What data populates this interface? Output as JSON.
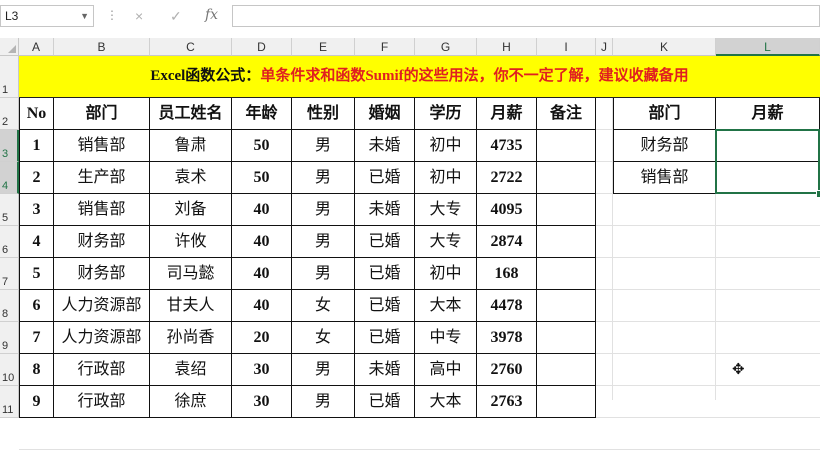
{
  "toolbar": {
    "name_box": "L3",
    "cancel_icon": "×",
    "enter_icon": "✓",
    "fx_label": "fx",
    "formula_value": ""
  },
  "columns": [
    "A",
    "B",
    "C",
    "D",
    "E",
    "F",
    "G",
    "H",
    "I",
    "J",
    "K",
    "L"
  ],
  "selected_column": "L",
  "rows": [
    "1",
    "2",
    "3",
    "4",
    "5",
    "6",
    "7",
    "8",
    "9",
    "10",
    "11"
  ],
  "selected_rows": [
    "3",
    "4"
  ],
  "title": {
    "part1": "Excel函数公式：",
    "part2": "单条件求和函数Sumif的这些用法，你不一定了解，建议收藏备用"
  },
  "main_table": {
    "headers": [
      "No",
      "部门",
      "员工姓名",
      "年龄",
      "性别",
      "婚姻",
      "学历",
      "月薪",
      "备注"
    ],
    "rows": [
      [
        "1",
        "销售部",
        "鲁肃",
        "50",
        "男",
        "未婚",
        "初中",
        "4735",
        ""
      ],
      [
        "2",
        "生产部",
        "袁术",
        "50",
        "男",
        "已婚",
        "初中",
        "2722",
        ""
      ],
      [
        "3",
        "销售部",
        "刘备",
        "40",
        "男",
        "未婚",
        "大专",
        "4095",
        ""
      ],
      [
        "4",
        "财务部",
        "许攸",
        "40",
        "男",
        "已婚",
        "大专",
        "2874",
        ""
      ],
      [
        "5",
        "财务部",
        "司马懿",
        "40",
        "男",
        "已婚",
        "初中",
        "168",
        ""
      ],
      [
        "6",
        "人力资源部",
        "甘夫人",
        "40",
        "女",
        "已婚",
        "大本",
        "4478",
        ""
      ],
      [
        "7",
        "人力资源部",
        "孙尚香",
        "20",
        "女",
        "已婚",
        "中专",
        "3978",
        ""
      ],
      [
        "8",
        "行政部",
        "袁绍",
        "30",
        "男",
        "未婚",
        "高中",
        "2760",
        ""
      ],
      [
        "9",
        "行政部",
        "徐庶",
        "30",
        "男",
        "已婚",
        "大本",
        "2763",
        ""
      ]
    ]
  },
  "side_table": {
    "headers": [
      "部门",
      "月薪"
    ],
    "rows": [
      [
        "财务部",
        ""
      ],
      [
        "销售部",
        ""
      ]
    ]
  },
  "colors": {
    "banner_bg": "#ffff00",
    "banner_highlight": "#e02020",
    "selection": "#217346"
  }
}
